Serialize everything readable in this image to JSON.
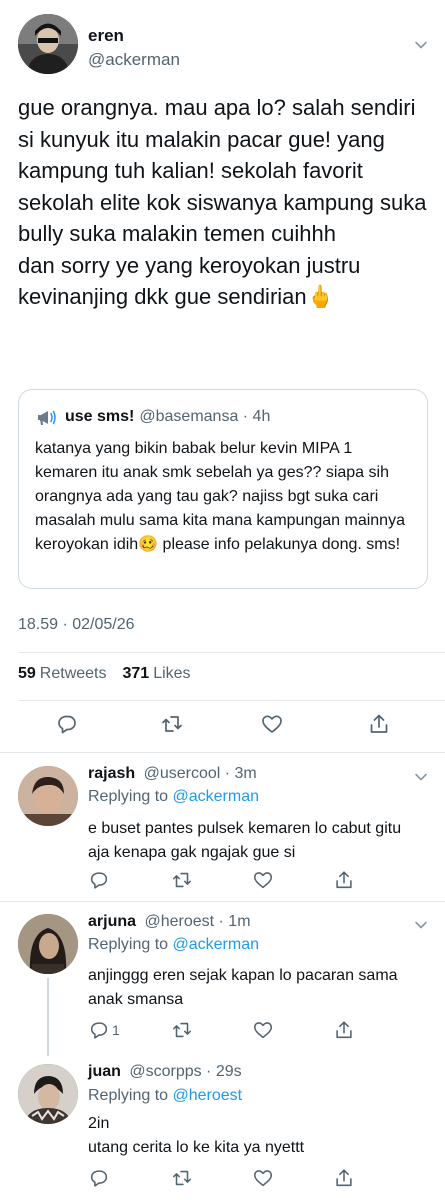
{
  "tweet": {
    "author_name": "eren",
    "author_handle": "@ackerman",
    "text": "gue orangnya. mau apa lo? salah sendiri si kunyuk itu malakin pacar gue! yang kampung tuh kalian! sekolah favorit sekolah elite kok siswanya kampung suka bully suka malakin temen cuihhh\ndan sorry ye yang keroyokan justru kevinanjing dkk gue sendirian🖕",
    "timestamp": "18.59 · 02/05/26",
    "retweets": "59",
    "retweets_label": "Retweets",
    "likes": "371",
    "likes_label": "Likes"
  },
  "quoted": {
    "icon": "megaphone-icon",
    "name": "use sms!",
    "meta": "@basemansa · 4h",
    "text": "katanya yang bikin babak belur kevin MIPA 1 kemaren itu anak smk sebelah ya ges?? siapa sih orangnya ada yang tau gak? najiss bgt suka cari masalah mulu sama kita mana kampungan mainnya keroyokan idih🥴 please info pelakunya dong. sms!"
  },
  "replies": [
    {
      "name": "rajash",
      "meta": "@usercool · 3m",
      "replying_prefix": "Replying to",
      "replying_to": "@ackerman",
      "text": "e buset pantes pulsek kemaren lo cabut gitu aja kenapa gak ngajak gue si",
      "reply_count": ""
    },
    {
      "name": "arjuna",
      "meta": "@heroest · 1m",
      "replying_prefix": "Replying to",
      "replying_to": "@ackerman",
      "text": "anjinggg eren sejak kapan lo pacaran sama anak smansa",
      "reply_count": "1"
    },
    {
      "name": "juan",
      "meta": "@scorpps · 29s",
      "replying_prefix": "Replying to",
      "replying_to": "@heroest",
      "text": "2in\nutang cerita lo ke kita ya nyettt",
      "reply_count": ""
    }
  ],
  "colors": {
    "text": "#0f1419",
    "muted": "#536471",
    "link": "#1d9bf0",
    "border": "#cfd9de"
  }
}
